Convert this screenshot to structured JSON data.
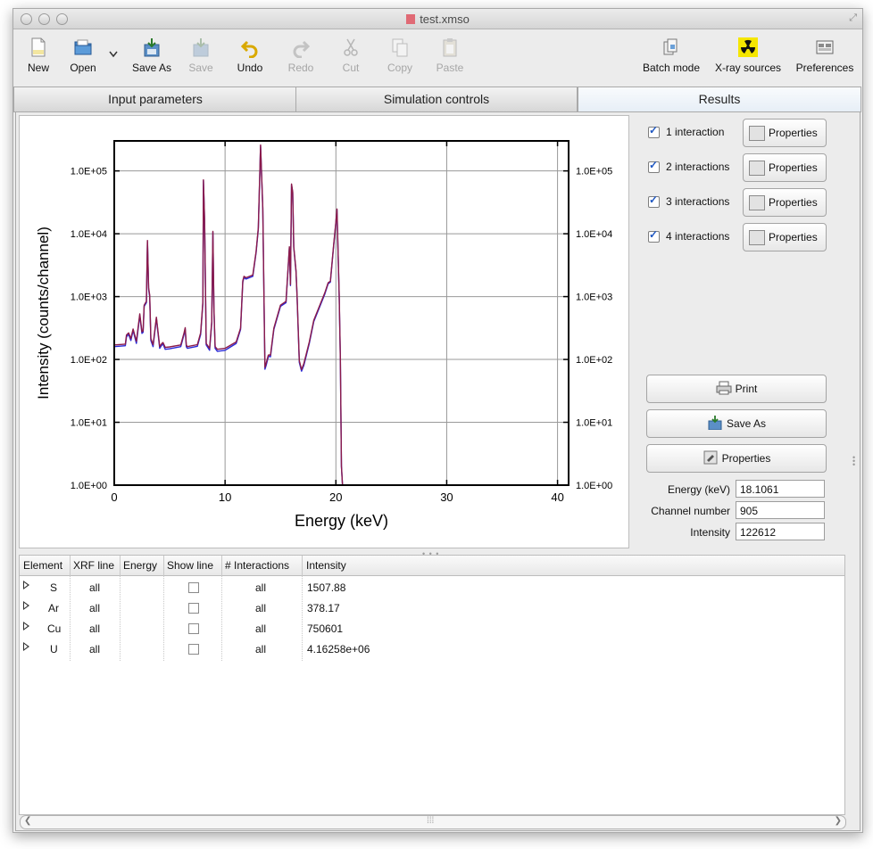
{
  "window": {
    "title": "test.xmso"
  },
  "toolbar": {
    "new": "New",
    "open": "Open",
    "save_as": "Save As",
    "save": "Save",
    "undo": "Undo",
    "redo": "Redo",
    "cut": "Cut",
    "copy": "Copy",
    "paste": "Paste",
    "batch_mode": "Batch mode",
    "xray_sources": "X-ray sources",
    "preferences": "Preferences"
  },
  "tabs": [
    {
      "label": "Input parameters"
    },
    {
      "label": "Simulation controls"
    },
    {
      "label": "Results"
    }
  ],
  "plot": {
    "xlabel": "Energy (keV)",
    "ylabel": "Intensity (counts/channel)"
  },
  "chart_data": {
    "type": "line",
    "xlabel": "Energy (keV)",
    "ylabel": "Intensity (counts/channel)",
    "xlim": [
      0,
      41
    ],
    "ylim": [
      1,
      300000
    ],
    "yscale": "log",
    "x_ticks": [
      "0",
      "10",
      "20",
      "30",
      "40"
    ],
    "y_ticks": [
      "1.0E+00",
      "1.0E+01",
      "1.0E+02",
      "1.0E+03",
      "1.0E+04",
      "1.0E+05"
    ],
    "grid": true,
    "series": [
      {
        "color": "#2a2ad8",
        "x": [
          0,
          1.0,
          1.1,
          1.3,
          1.5,
          1.7,
          2.0,
          2.3,
          2.5,
          2.6,
          2.7,
          2.9,
          3.0,
          3.1,
          3.2,
          3.3,
          3.5,
          3.8,
          4.1,
          4.3,
          4.4,
          4.6,
          5.0,
          6.0,
          6.3,
          6.4,
          6.5,
          6.6,
          7.0,
          7.5,
          7.8,
          8.0,
          8.05,
          8.15,
          8.3,
          8.6,
          8.8,
          8.9,
          9.0,
          9.1,
          9.3,
          10.0,
          11.0,
          11.4,
          11.6,
          11.7,
          11.9,
          12.5,
          12.8,
          13.0,
          13.2,
          13.4,
          13.6,
          13.7,
          13.9,
          14.0,
          14.1,
          14.4,
          15.0,
          15.5,
          15.8,
          15.9,
          16.0,
          16.1,
          16.2,
          16.4,
          16.5,
          16.7,
          16.9,
          17.1,
          17.3,
          17.6,
          18.0,
          19.0,
          19.3,
          19.5,
          19.8,
          20.0,
          20.1,
          20.3,
          20.4,
          20.5,
          20.6,
          41
        ],
        "y": [
          160,
          165,
          230,
          250,
          200,
          290,
          180,
          500,
          260,
          270,
          700,
          800,
          7500,
          1300,
          1000,
          200,
          160,
          450,
          150,
          170,
          175,
          145,
          148,
          160,
          250,
          300,
          160,
          150,
          155,
          162,
          250,
          800,
          70000,
          16000,
          170,
          140,
          380,
          10500,
          600,
          150,
          135,
          140,
          180,
          300,
          1700,
          2000,
          1900,
          2100,
          5000,
          12000,
          250000,
          25000,
          70,
          80,
          110,
          112,
          110,
          300,
          700,
          800,
          6000,
          1500,
          60000,
          45000,
          6000,
          2500,
          1000,
          90,
          65,
          80,
          110,
          180,
          400,
          1100,
          1600,
          1700,
          6500,
          15000,
          24000,
          1000,
          100,
          2,
          1,
          1
        ]
      },
      {
        "color": "#8b1a4a",
        "x": [
          0,
          1.0,
          1.1,
          1.3,
          1.5,
          1.7,
          2.0,
          2.3,
          2.5,
          2.6,
          2.7,
          2.9,
          3.0,
          3.1,
          3.2,
          3.3,
          3.5,
          3.8,
          4.1,
          4.3,
          4.4,
          4.6,
          5.0,
          6.0,
          6.3,
          6.4,
          6.5,
          6.6,
          7.0,
          7.5,
          7.8,
          8.0,
          8.05,
          8.15,
          8.3,
          8.6,
          8.8,
          8.9,
          9.0,
          9.1,
          9.3,
          10.0,
          11.0,
          11.4,
          11.6,
          11.7,
          11.9,
          12.5,
          12.8,
          13.0,
          13.2,
          13.4,
          13.6,
          13.7,
          13.9,
          14.0,
          14.1,
          14.4,
          15.0,
          15.5,
          15.8,
          15.9,
          16.0,
          16.1,
          16.2,
          16.4,
          16.5,
          16.7,
          16.9,
          17.1,
          17.3,
          17.6,
          18.0,
          19.0,
          19.3,
          19.5,
          19.8,
          20.0,
          20.1,
          20.3,
          20.4,
          20.5,
          20.6,
          41
        ],
        "y": [
          170,
          175,
          245,
          265,
          215,
          305,
          195,
          530,
          275,
          285,
          730,
          840,
          7800,
          1380,
          1060,
          215,
          172,
          470,
          160,
          180,
          186,
          155,
          158,
          170,
          265,
          320,
          170,
          160,
          165,
          172,
          265,
          840,
          72000,
          16500,
          180,
          150,
          400,
          10900,
          630,
          160,
          145,
          150,
          190,
          315,
          1780,
          2100,
          2000,
          2200,
          5200,
          12500,
          258000,
          26000,
          75,
          86,
          117,
          118,
          117,
          315,
          730,
          840,
          6200,
          1560,
          62000,
          46500,
          6200,
          2600,
          1050,
          96,
          69,
          85,
          117,
          190,
          420,
          1150,
          1660,
          1760,
          6700,
          15500,
          24800,
          1050,
          105,
          2,
          1,
          1
        ]
      }
    ]
  },
  "results_panel": {
    "interactions": [
      {
        "label": "1 interaction",
        "checked": true,
        "button": "Properties"
      },
      {
        "label": "2 interactions",
        "checked": true,
        "button": "Properties"
      },
      {
        "label": "3 interactions",
        "checked": true,
        "button": "Properties"
      },
      {
        "label": "4 interactions",
        "checked": true,
        "button": "Properties"
      }
    ],
    "print": "Print",
    "save_as": "Save As",
    "properties": "Properties",
    "fields": {
      "energy_label": "Energy (keV)",
      "energy_value": "18.1061",
      "channel_label": "Channel number",
      "channel_value": "905",
      "intensity_label": "Intensity",
      "intensity_value": "122612"
    }
  },
  "table": {
    "headers": [
      "Element",
      "XRF line",
      "Energy",
      "Show line",
      "# Interactions",
      "Intensity"
    ],
    "rows": [
      {
        "element": "S",
        "xrf_line": "all",
        "energy": "",
        "show_line": false,
        "interactions": "all",
        "intensity": "1507.88"
      },
      {
        "element": "Ar",
        "xrf_line": "all",
        "energy": "",
        "show_line": false,
        "interactions": "all",
        "intensity": "378.17"
      },
      {
        "element": "Cu",
        "xrf_line": "all",
        "energy": "",
        "show_line": false,
        "interactions": "all",
        "intensity": "750601"
      },
      {
        "element": "U",
        "xrf_line": "all",
        "energy": "",
        "show_line": false,
        "interactions": "all",
        "intensity": "4.16258e+06"
      }
    ]
  }
}
